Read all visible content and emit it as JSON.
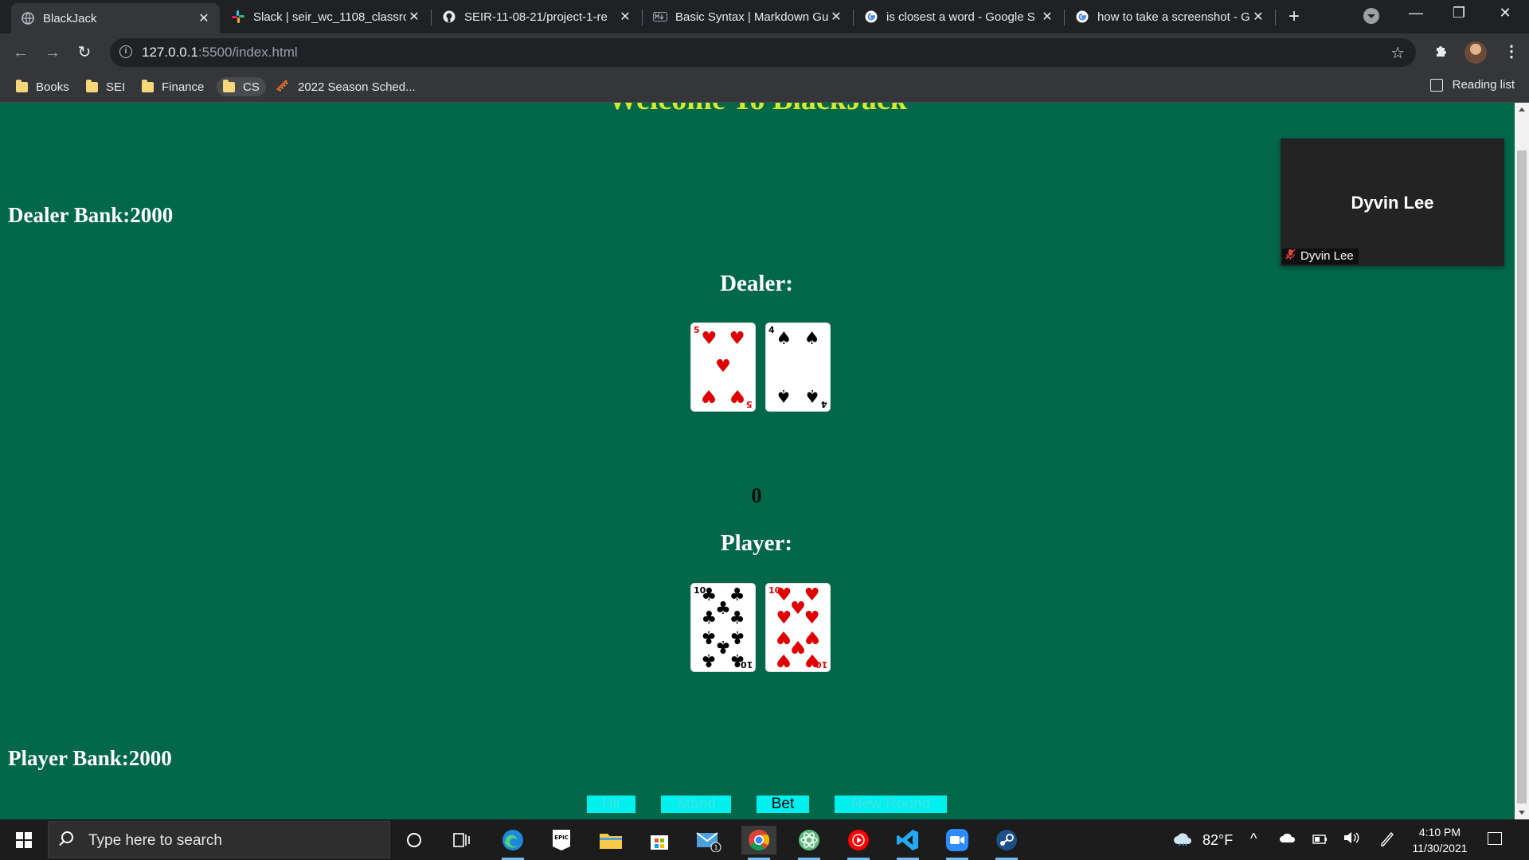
{
  "browser": {
    "tabs": [
      {
        "title": "BlackJack",
        "favicon": "globe-icon",
        "active": true
      },
      {
        "title": "Slack | seir_wc_1108_classro",
        "favicon": "slack-icon"
      },
      {
        "title": "SEIR-11-08-21/project-1-re",
        "favicon": "github-icon"
      },
      {
        "title": "Basic Syntax | Markdown Gu",
        "favicon": "markdown-icon"
      },
      {
        "title": "is closest a word - Google S",
        "favicon": "google-icon"
      },
      {
        "title": "how to take a screenshot - G",
        "favicon": "google-icon"
      }
    ],
    "url_host": "127.0.0.1",
    "url_rest": ":5500/index.html",
    "bookmarks": [
      {
        "label": "Books",
        "icon": "folder-icon"
      },
      {
        "label": "SEI",
        "icon": "folder-icon"
      },
      {
        "label": "Finance",
        "icon": "folder-icon"
      },
      {
        "label": "CS",
        "icon": "folder-icon"
      },
      {
        "label": "2022 Season Sched...",
        "icon": "ticket-icon"
      }
    ],
    "reading_list": "Reading list"
  },
  "game": {
    "title": "Welcome To BlackJack",
    "dealer_bank": "Dealer Bank:2000",
    "dealer_heading": "Dealer:",
    "score": "0",
    "player_heading": "Player:",
    "player_bank": "Player Bank:2000",
    "dealer_cards": [
      {
        "rank": "5",
        "suit": "hearts",
        "symbol": "♥",
        "color": "#e10000"
      },
      {
        "rank": "4",
        "suit": "spades",
        "symbol": "♠",
        "color": "#000000"
      }
    ],
    "player_cards": [
      {
        "rank": "10",
        "suit": "clubs",
        "symbol": "♣",
        "color": "#000000"
      },
      {
        "rank": "10",
        "suit": "hearts",
        "symbol": "♥",
        "color": "#e10000"
      }
    ],
    "buttons": {
      "hit": "Hit",
      "stand": "Stand",
      "bet": "Bet",
      "new_round": "New Round"
    },
    "colors": {
      "felt": "#03684a",
      "title": "#d6e82c",
      "button": "#00f0f0"
    }
  },
  "video_tile": {
    "name": "Dyvin Lee",
    "label": "Dyvin Lee",
    "muted_icon": "mic-off-icon"
  },
  "taskbar": {
    "search_placeholder": "Type here to search",
    "weather": "82°F",
    "time": "4:10 PM",
    "date": "11/30/2021",
    "mail_badge": "1"
  }
}
